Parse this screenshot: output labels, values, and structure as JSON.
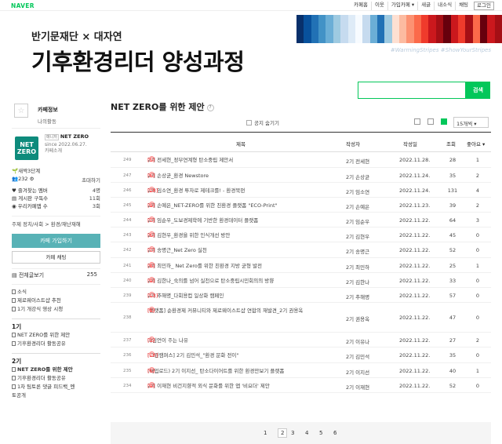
{
  "topbar": {
    "logo": "NAVER",
    "menu": [
      "카페홈",
      "이웃",
      "가입카페 ▾",
      "새글",
      "내소식",
      "채팅"
    ],
    "login": "로그인"
  },
  "banner": {
    "subtitle": "반기문재단 × 대자연",
    "title": "기후환경리더 양성과정",
    "hashtag": "#WarmingStripes #ShowYourStripes"
  },
  "search": {
    "placeholder": "",
    "button": "검색"
  },
  "sidebar": {
    "profile": {
      "title": "카페정보",
      "sub": "나의활동"
    },
    "cafe": {
      "icon": "NET ZERO",
      "manager_badge": "매니저",
      "manager": "NET ZERO",
      "since": "since 2022.06.27.",
      "intro": "카페소개"
    },
    "level": "새싹3단계",
    "members": {
      "count": "232",
      "invite": "초대하기"
    },
    "stats": [
      {
        "label": "즐겨찾는 멤버",
        "value": "4명"
      },
      {
        "label": "게시판 구독수",
        "value": "11회"
      },
      {
        "label": "우리카페앱 수",
        "value": "3회"
      }
    ],
    "catpath": "주제 정치/사회 > 환경/재난재해",
    "join": "카페 가입하기",
    "chat": "카페 채팅",
    "allpost": {
      "label": "전체글보기",
      "count": "255"
    },
    "menu1": [
      "소식",
      "제로웨이스트샵 추천",
      "1기 개강식 영상 시청"
    ],
    "sec1": "1기",
    "menu2": [
      "NET ZERO를 위한 제안",
      "기후환경리더 활동공유"
    ],
    "sec2": "2기",
    "menu3": [
      "NET ZERO를 위한 제안",
      "기후환경리더 활동공유",
      "1차 팀토론 댓글 피드백_멘",
      "토공개"
    ]
  },
  "main": {
    "title": "NET ZERO를 위한 제안",
    "notice": "공지 숨기기",
    "per_page": "15개씩 ▾",
    "cols": {
      "title": "제목",
      "author": "작성자",
      "date": "작성일",
      "views": "조회",
      "likes": "좋아요 ▾"
    },
    "rows": [
      {
        "num": "249",
        "title": "2기 전세현_정부연계형 탄소중립 제안서",
        "cnt": "[5]",
        "author": "2기 전세현",
        "date": "2022.11.28.",
        "views": "28",
        "likes": "1"
      },
      {
        "num": "247",
        "title": "2기 손상균_환경 Newstore",
        "cnt": "[6]",
        "author": "2기 손상균",
        "date": "2022.11.24.",
        "views": "35",
        "likes": "2"
      },
      {
        "num": "246",
        "title": "2기 임소연_환경 투자로 제테크를! - 환경북펀",
        "cnt": "[28]",
        "author": "2기 임소연",
        "date": "2022.11.24.",
        "views": "131",
        "likes": "4"
      },
      {
        "num": "245",
        "title": "2기 손예은_NET-ZERO를 위한 친환경 플랫폼 \"ECO-Print\"",
        "cnt": "[9]",
        "author": "2기 손예은",
        "date": "2022.11.23.",
        "views": "39",
        "likes": "2"
      },
      {
        "num": "244",
        "title": "2기 임순우_도보경제학에 기반한 환경데이터 플랫폼",
        "cnt": "[7]",
        "author": "2기 임순우",
        "date": "2022.11.22.",
        "views": "64",
        "likes": "3"
      },
      {
        "num": "243",
        "title": "2기 김현우_환경을 위한 인식개선 방안",
        "cnt": "[6]",
        "author": "2기 김현우",
        "date": "2022.11.22.",
        "views": "45",
        "likes": "0"
      },
      {
        "num": "242",
        "title": "2기 송명근_Net Zero 실천",
        "cnt": "[7]",
        "author": "2기 송명근",
        "date": "2022.11.22.",
        "views": "52",
        "likes": "0"
      },
      {
        "num": "241",
        "title": "2기 최민하_ Net Zero를 위한 친환경 지방 균형 발전",
        "cnt": "[8]",
        "author": "2기 최민하",
        "date": "2022.11.22.",
        "views": "25",
        "likes": "1"
      },
      {
        "num": "240",
        "title": "2기 김한나_숙의를 넘어 실천으로 탄소중립시민회의의 방향",
        "cnt": "[9]",
        "author": "2기 김한나",
        "date": "2022.11.22.",
        "views": "33",
        "likes": "0"
      },
      {
        "num": "239",
        "title": "2기 추해명_다회용컵 일상화 캠페인",
        "cnt": "[13]",
        "author": "2기 추해명",
        "date": "2022.11.22.",
        "views": "57",
        "likes": "0"
      },
      {
        "num": "238",
        "title": "[플랫폼] 순환경제 커뮤니티와 제로웨이스트샵 연합의 재발견_2기 권용옥",
        "cnt": "[8]",
        "author": "2기 권용옥",
        "date": "2022.11.22.",
        "views": "47",
        "likes": "0"
      },
      {
        "num": "237",
        "title": "아임언이 주는 나유",
        "cnt": "[3]",
        "author": "2기 이유나",
        "date": "2022.11.22.",
        "views": "27",
        "likes": "2"
      },
      {
        "num": "236",
        "title": "[그린캠퍼스] 2기 김민석_\"환경 문화 전이\"",
        "cnt": "[10]",
        "author": "2기 김민석",
        "date": "2022.11.22.",
        "views": "35",
        "likes": "0"
      },
      {
        "num": "235",
        "title": "(재업로드) 2기 이지선_ 탄소다이어트를 위한 환경만보기 플랫폼",
        "cnt": "[6]",
        "author": "2기 이지선",
        "date": "2022.11.22.",
        "views": "40",
        "likes": "1"
      },
      {
        "num": "234",
        "title": "2기 이재현 비건지향적 외식 문화를 위한 앱 '비요더' 제안",
        "cnt": "[9]",
        "author": "2기 이재현",
        "date": "2022.11.22.",
        "views": "52",
        "likes": "0"
      }
    ]
  },
  "pager": {
    "pages": [
      "1",
      "2",
      "3",
      "4",
      "5",
      "6"
    ],
    "current": "2"
  },
  "colors": {
    "naver_green": "#03c75a",
    "join_button": "#58b2b6",
    "cafe_icon": "#0e8b7c",
    "comment_count": "#ff3333"
  }
}
